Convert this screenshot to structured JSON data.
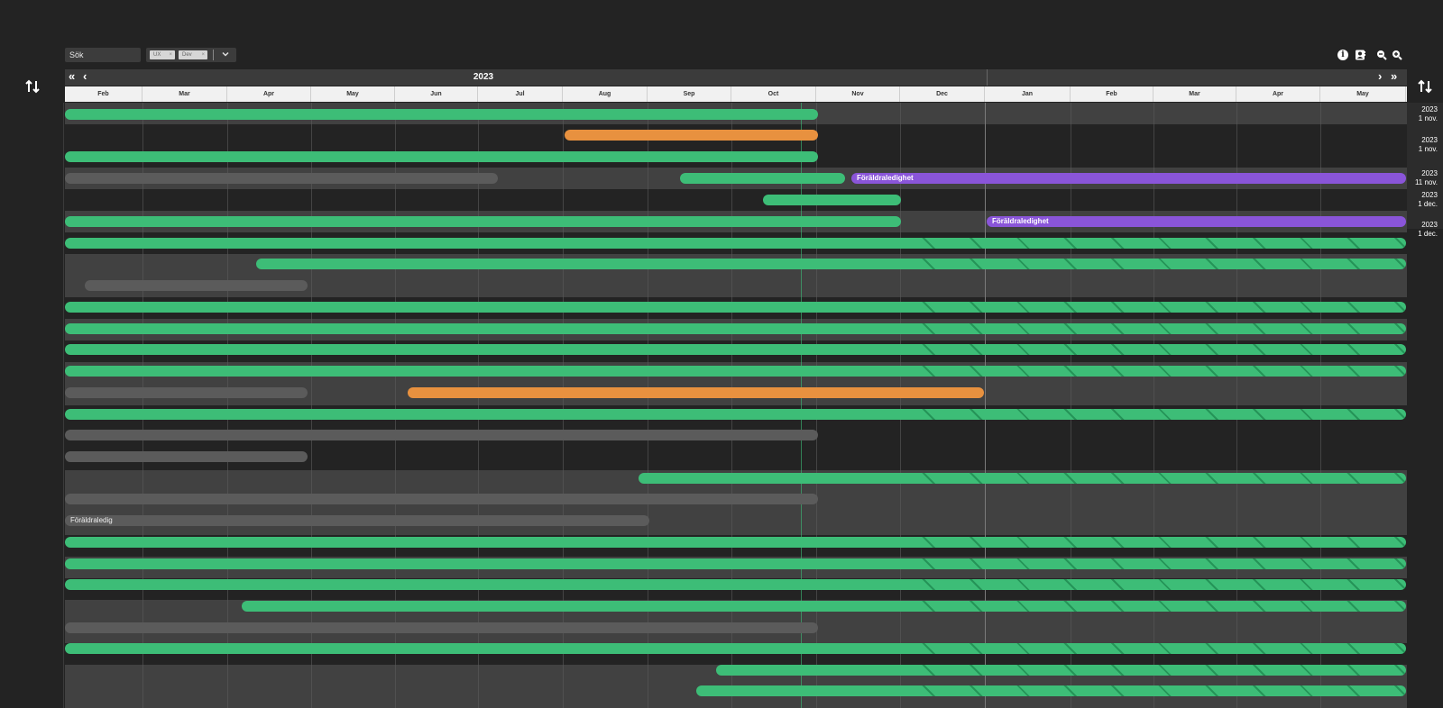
{
  "toolbar": {
    "search_label": "Sök",
    "filter_chips": [
      "UX",
      "Dev"
    ],
    "chip_close_icon": "×",
    "dropdown_icon": "chevron-down-icon",
    "icons": [
      "info-icon",
      "contact-card-icon",
      "zoom-out-icon",
      "zoom-in-icon"
    ]
  },
  "timeline": {
    "year_label": "2023",
    "nav": {
      "first": "«",
      "prev": "‹",
      "next": "›",
      "last": "»"
    },
    "months": [
      "Feb",
      "Mar",
      "Apr",
      "May",
      "Jun",
      "Jul",
      "Aug",
      "Sep",
      "Oct",
      "Nov",
      "Dec",
      "Jan",
      "Feb",
      "Mar",
      "Apr",
      "May"
    ],
    "sort_icon": "sort-up-down-icon"
  },
  "rows": [
    {
      "bars": [
        {
          "kind": "green",
          "label": ""
        }
      ],
      "end_year": "2023",
      "end_date": "1 nov."
    },
    {
      "bars": [
        {
          "kind": "orange",
          "label": ""
        }
      ],
      "end_year": "2023",
      "end_date": "1 nov."
    },
    {
      "bars": [
        {
          "kind": "green",
          "label": ""
        }
      ],
      "end_year": "",
      "": ""
    },
    {
      "bars": [
        {
          "kind": "gray",
          "label": ""
        },
        {
          "kind": "green",
          "label": ""
        },
        {
          "kind": "purple",
          "label": "Föräldraledighet"
        }
      ],
      "end_year": "2023",
      "end_date": "11 nov."
    },
    {
      "bars": [
        {
          "kind": "green",
          "label": ""
        }
      ],
      "end_year": "2023",
      "end_date": "1 dec."
    },
    {
      "bars": [
        {
          "kind": "green",
          "label": ""
        },
        {
          "kind": "purple",
          "label": "Föräldraledighet"
        }
      ],
      "end_year": "2023",
      "end_date": "1 dec."
    },
    {
      "bars": [
        {
          "kind": "gray",
          "label": "Föräldraledig"
        }
      ]
    }
  ],
  "colors": {
    "green": "#3dbd77",
    "orange": "#e8913f",
    "purple": "#8a55d9",
    "gray": "#5b5b5b",
    "background": "#232323"
  }
}
